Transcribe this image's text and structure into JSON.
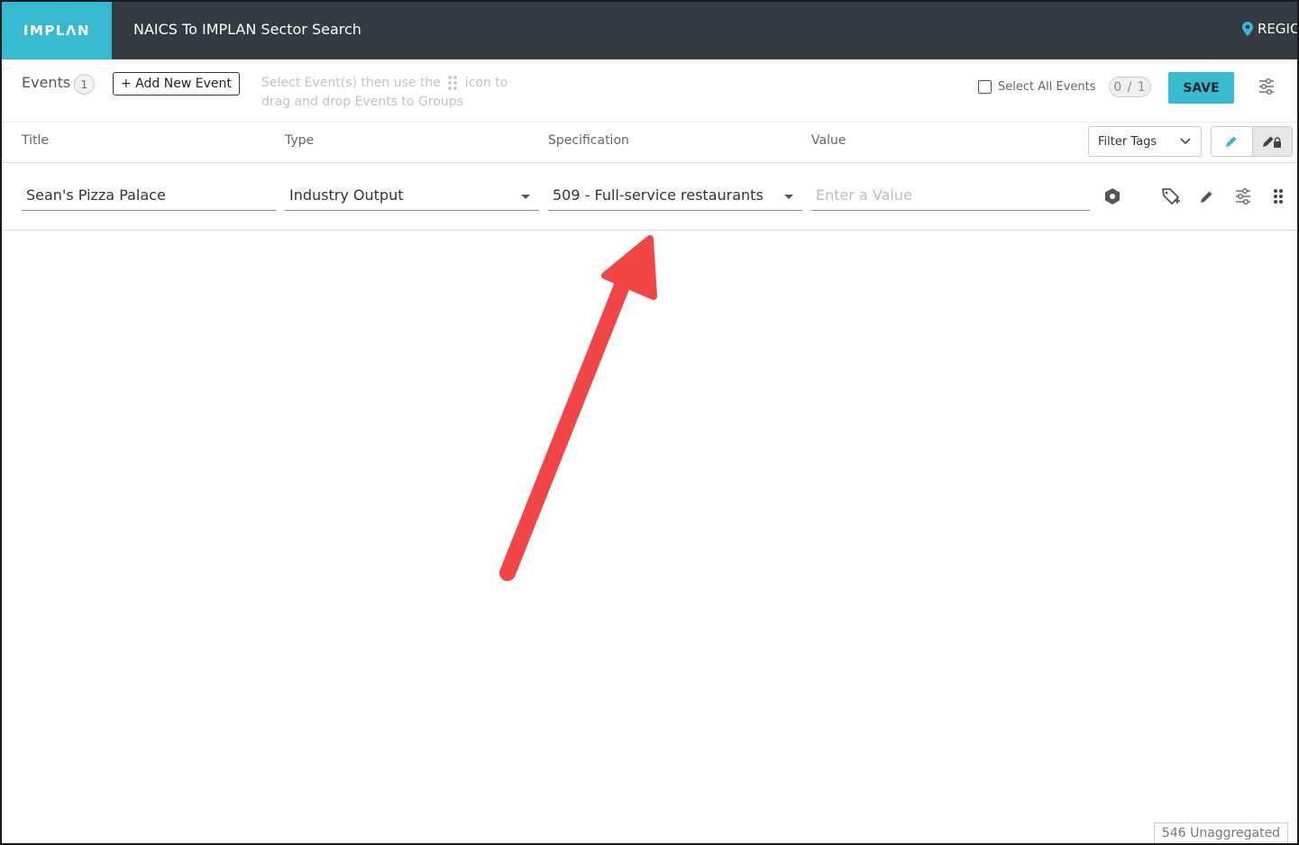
{
  "topbar": {
    "logo": "IMPLΛN",
    "app_title": "NAICS To IMPLAN Sector Search",
    "region_label": "REGIC"
  },
  "toolbar": {
    "events_label": "Events",
    "events_count": "1",
    "add_event_label": "+ Add New Event",
    "hint_before": "Select Event(s) then use the",
    "hint_after": "icon to drag and drop Events to Groups",
    "select_all_label": "Select All Events",
    "selected_count": "0 / 1",
    "save_label": "SAVE"
  },
  "columns": {
    "title": "Title",
    "type": "Type",
    "specification": "Specification",
    "value": "Value",
    "filter_tags_label": "Filter Tags"
  },
  "event": {
    "title": "Sean's Pizza Palace",
    "type": "Industry Output",
    "specification": "509 - Full-service restaurants",
    "value_placeholder": "Enter a Value"
  },
  "footer": {
    "unaggregated": "546 Unaggregated"
  },
  "colors": {
    "accent": "#37b9cf",
    "topbar": "#343a42",
    "annotation_arrow": "#f24646"
  }
}
